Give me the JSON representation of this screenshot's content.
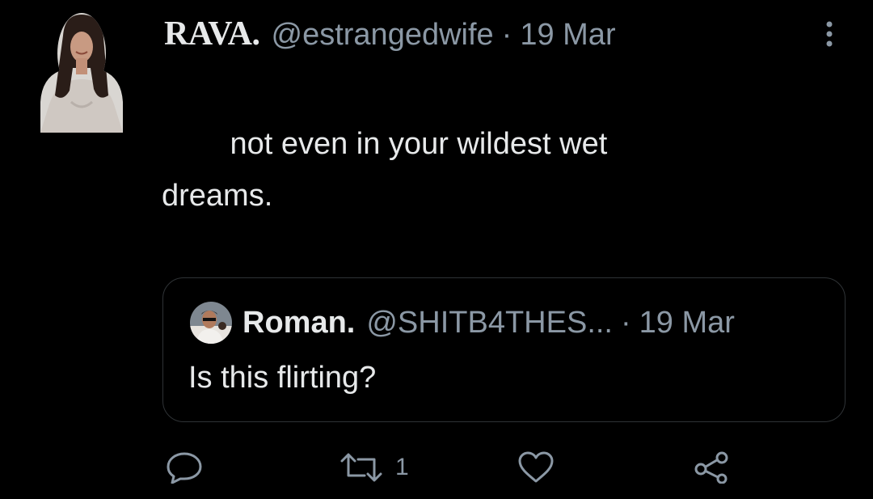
{
  "tweet": {
    "author": {
      "name": "RAVA.",
      "handle": "@estrangedwife",
      "separator": "·",
      "date": "19 Mar",
      "avatar_icon": "profile-photo-woman"
    },
    "text_line1": "        not even in your wildest wet",
    "text_line2": "dreams.",
    "more_icon": "more-vertical-icon",
    "quoted": {
      "name": "Roman.",
      "handle": "@SHITB4THES...",
      "separator": "·",
      "date": "19 Mar",
      "text": "Is this flirting?",
      "avatar_icon": "profile-photo-man"
    },
    "actions": {
      "reply_icon": "reply-icon",
      "retweet_icon": "retweet-icon",
      "retweet_count": "1",
      "like_icon": "heart-icon",
      "share_icon": "share-icon"
    }
  },
  "colors": {
    "background": "#000000",
    "primary_text": "#e7e9ea",
    "secondary_text": "#8b98a5",
    "border": "#2f3336"
  }
}
